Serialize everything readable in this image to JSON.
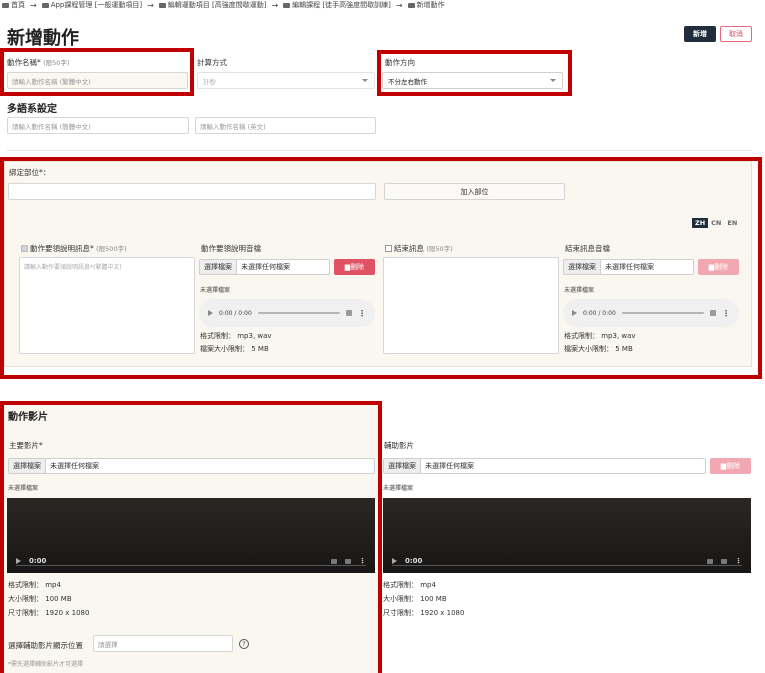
{
  "breadcrumb": {
    "home": "首頁",
    "items": [
      "App課程管理 [一般運動項目]",
      "編輯運動項目 [高強度間歇運動]",
      "編輯課程 [徒手高強度間歇訓練]",
      "新增動作"
    ]
  },
  "page": {
    "title": "新增動作",
    "add_label": "新增",
    "cancel_label": "取消"
  },
  "basic": {
    "name_label": "動作名稱*",
    "name_hint": "(限50字)",
    "name_placeholder": "請輸入動作名稱 (繁體中文)",
    "calc_label": "計算方式",
    "calc_value": "計秒",
    "direction_label": "動作方向",
    "direction_value": "不分左右動作"
  },
  "multilang": {
    "title": "多語系設定",
    "simplified_placeholder": "請輸入動作名稱 (簡體中文)",
    "english_placeholder": "請輸入動作名稱 (英文)"
  },
  "binding": {
    "label": "綁定部位*：",
    "add_part_label": "加入部位",
    "langs": [
      "ZH",
      "CN",
      "EN"
    ],
    "active_lang": "ZH",
    "desc_label": "動作要領說明訊息*",
    "desc_hint": "(限500字)",
    "desc_placeholder": "請輸入動作要領說明訊息*(繁體中文)",
    "desc_audio_label": "動作要領說明音檔",
    "end_label": "結束訊息",
    "end_hint": "(限50字)",
    "end_audio_label": "結束訊息音檔",
    "choose_file": "選擇檔案",
    "no_file": "未選擇任何檔案",
    "delete": "刪除",
    "no_file_selected": "未選擇檔案",
    "audio_time": "0:00 / 0:00",
    "format_limit": "格式限制： mp3, wav",
    "size_limit": "檔案大小限制： 5 MB"
  },
  "video": {
    "title": "動作影片",
    "main_label": "主要影片*",
    "aux_label": "輔助影片",
    "choose_file": "選擇檔案",
    "no_file": "未選擇任何檔案",
    "no_file_selected": "未選擇檔案",
    "time": "0:00",
    "delete": "刪除",
    "format_limit": "格式限制： mp4",
    "size_limit": "大小限制： 100 MB",
    "dim_limit": "尺寸限制： 1920 x 1080",
    "aux_position_label": "選擇輔助影片顯示位置",
    "aux_position_placeholder": "請選擇",
    "aux_note": "*需先選擇輔助影片才可選擇"
  },
  "colors": {
    "primary": "#1f2d3d",
    "danger": "#e05365",
    "highlight": "#c00000"
  }
}
